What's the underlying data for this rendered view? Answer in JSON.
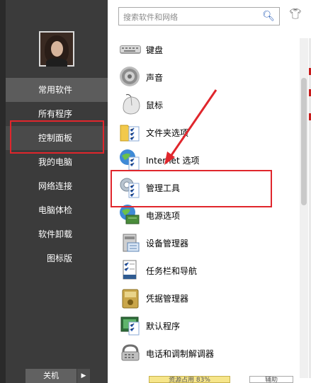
{
  "sidebar": {
    "items": [
      {
        "label": "常用软件"
      },
      {
        "label": "所有程序"
      },
      {
        "label": "控制面板"
      },
      {
        "label": "我的电脑"
      },
      {
        "label": "网络连接"
      },
      {
        "label": "电脑体检"
      },
      {
        "label": "软件卸载"
      },
      {
        "label": "图标版"
      }
    ],
    "shutdown_label": "关机",
    "shutdown_arrow": "▶"
  },
  "search": {
    "placeholder": "搜索软件和网络"
  },
  "list": {
    "items": [
      {
        "label": "键盘",
        "icon": "keyboard-icon"
      },
      {
        "label": "声音",
        "icon": "speaker-icon"
      },
      {
        "label": "鼠标",
        "icon": "mouse-icon"
      },
      {
        "label": "文件夹选项",
        "icon": "folder-options-icon"
      },
      {
        "label": "Internet 选项",
        "icon": "internet-options-icon"
      },
      {
        "label": "管理工具",
        "icon": "admin-tools-icon"
      },
      {
        "label": "电源选项",
        "icon": "power-options-icon"
      },
      {
        "label": "设备管理器",
        "icon": "device-manager-icon"
      },
      {
        "label": "任务栏和导航",
        "icon": "taskbar-icon"
      },
      {
        "label": "凭据管理器",
        "icon": "credential-manager-icon"
      },
      {
        "label": "默认程序",
        "icon": "default-programs-icon"
      },
      {
        "label": "电话和调制解调器",
        "icon": "phone-modem-icon"
      }
    ]
  },
  "footer": {
    "left_button": "资源占用 83%",
    "right_button": "辅助"
  },
  "colors": {
    "highlight_red": "#e0262c",
    "sidebar_bg": "#3b3b3b"
  }
}
